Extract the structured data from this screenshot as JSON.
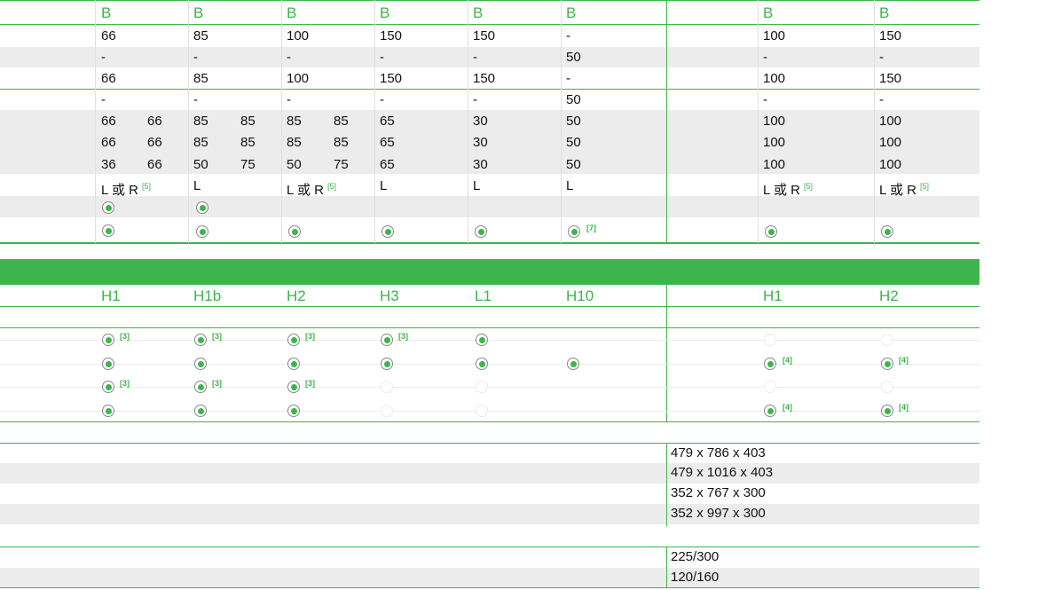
{
  "top_table": {
    "headers": [
      "B",
      "B",
      "B",
      "B",
      "B",
      "B",
      "B",
      "B"
    ],
    "rows": [
      [
        "66",
        "",
        "85",
        "",
        "100",
        "",
        "150",
        "",
        "150",
        "",
        "-",
        "100",
        "150"
      ],
      [
        "-",
        "",
        "-",
        "",
        "-",
        "",
        "-",
        "",
        "-",
        "",
        "50",
        "-",
        "-"
      ],
      [
        "66",
        "",
        "85",
        "",
        "100",
        "",
        "150",
        "",
        "150",
        "",
        "-",
        "100",
        "150"
      ],
      [
        "-",
        "",
        "-",
        "",
        "-",
        "",
        "-",
        "",
        "-",
        "",
        "50",
        "-",
        "-"
      ],
      [
        "66",
        "66",
        "85",
        "85",
        "85",
        "85",
        "65",
        "",
        "30",
        "",
        "50",
        "100",
        "100"
      ],
      [
        "66",
        "66",
        "85",
        "85",
        "85",
        "85",
        "65",
        "",
        "30",
        "",
        "50",
        "100",
        "100"
      ],
      [
        "36",
        "66",
        "50",
        "75",
        "50",
        "75",
        "65",
        "",
        "30",
        "",
        "50",
        "100",
        "100"
      ]
    ],
    "orientation": [
      "L 或 R",
      "L",
      "L 或 R",
      "L",
      "L",
      "L",
      "L 或 R",
      "L 或 R"
    ],
    "note5": "[5]",
    "note7": "[7]"
  },
  "mid_table": {
    "headers": [
      "H1",
      "H1b",
      "H2",
      "H3",
      "L1",
      "H10",
      "H1",
      "H2"
    ],
    "note3": "[3]",
    "note4": "[4]"
  },
  "dimensions": [
    "479 x 786 x 403",
    "479 x 1016 x 403",
    "352 x 767 x 300",
    "352 x 997 x 300"
  ],
  "ratios": [
    "225/300",
    "120/160"
  ],
  "colors": {
    "accent": "#3db54a",
    "stripe": "#ececec"
  }
}
